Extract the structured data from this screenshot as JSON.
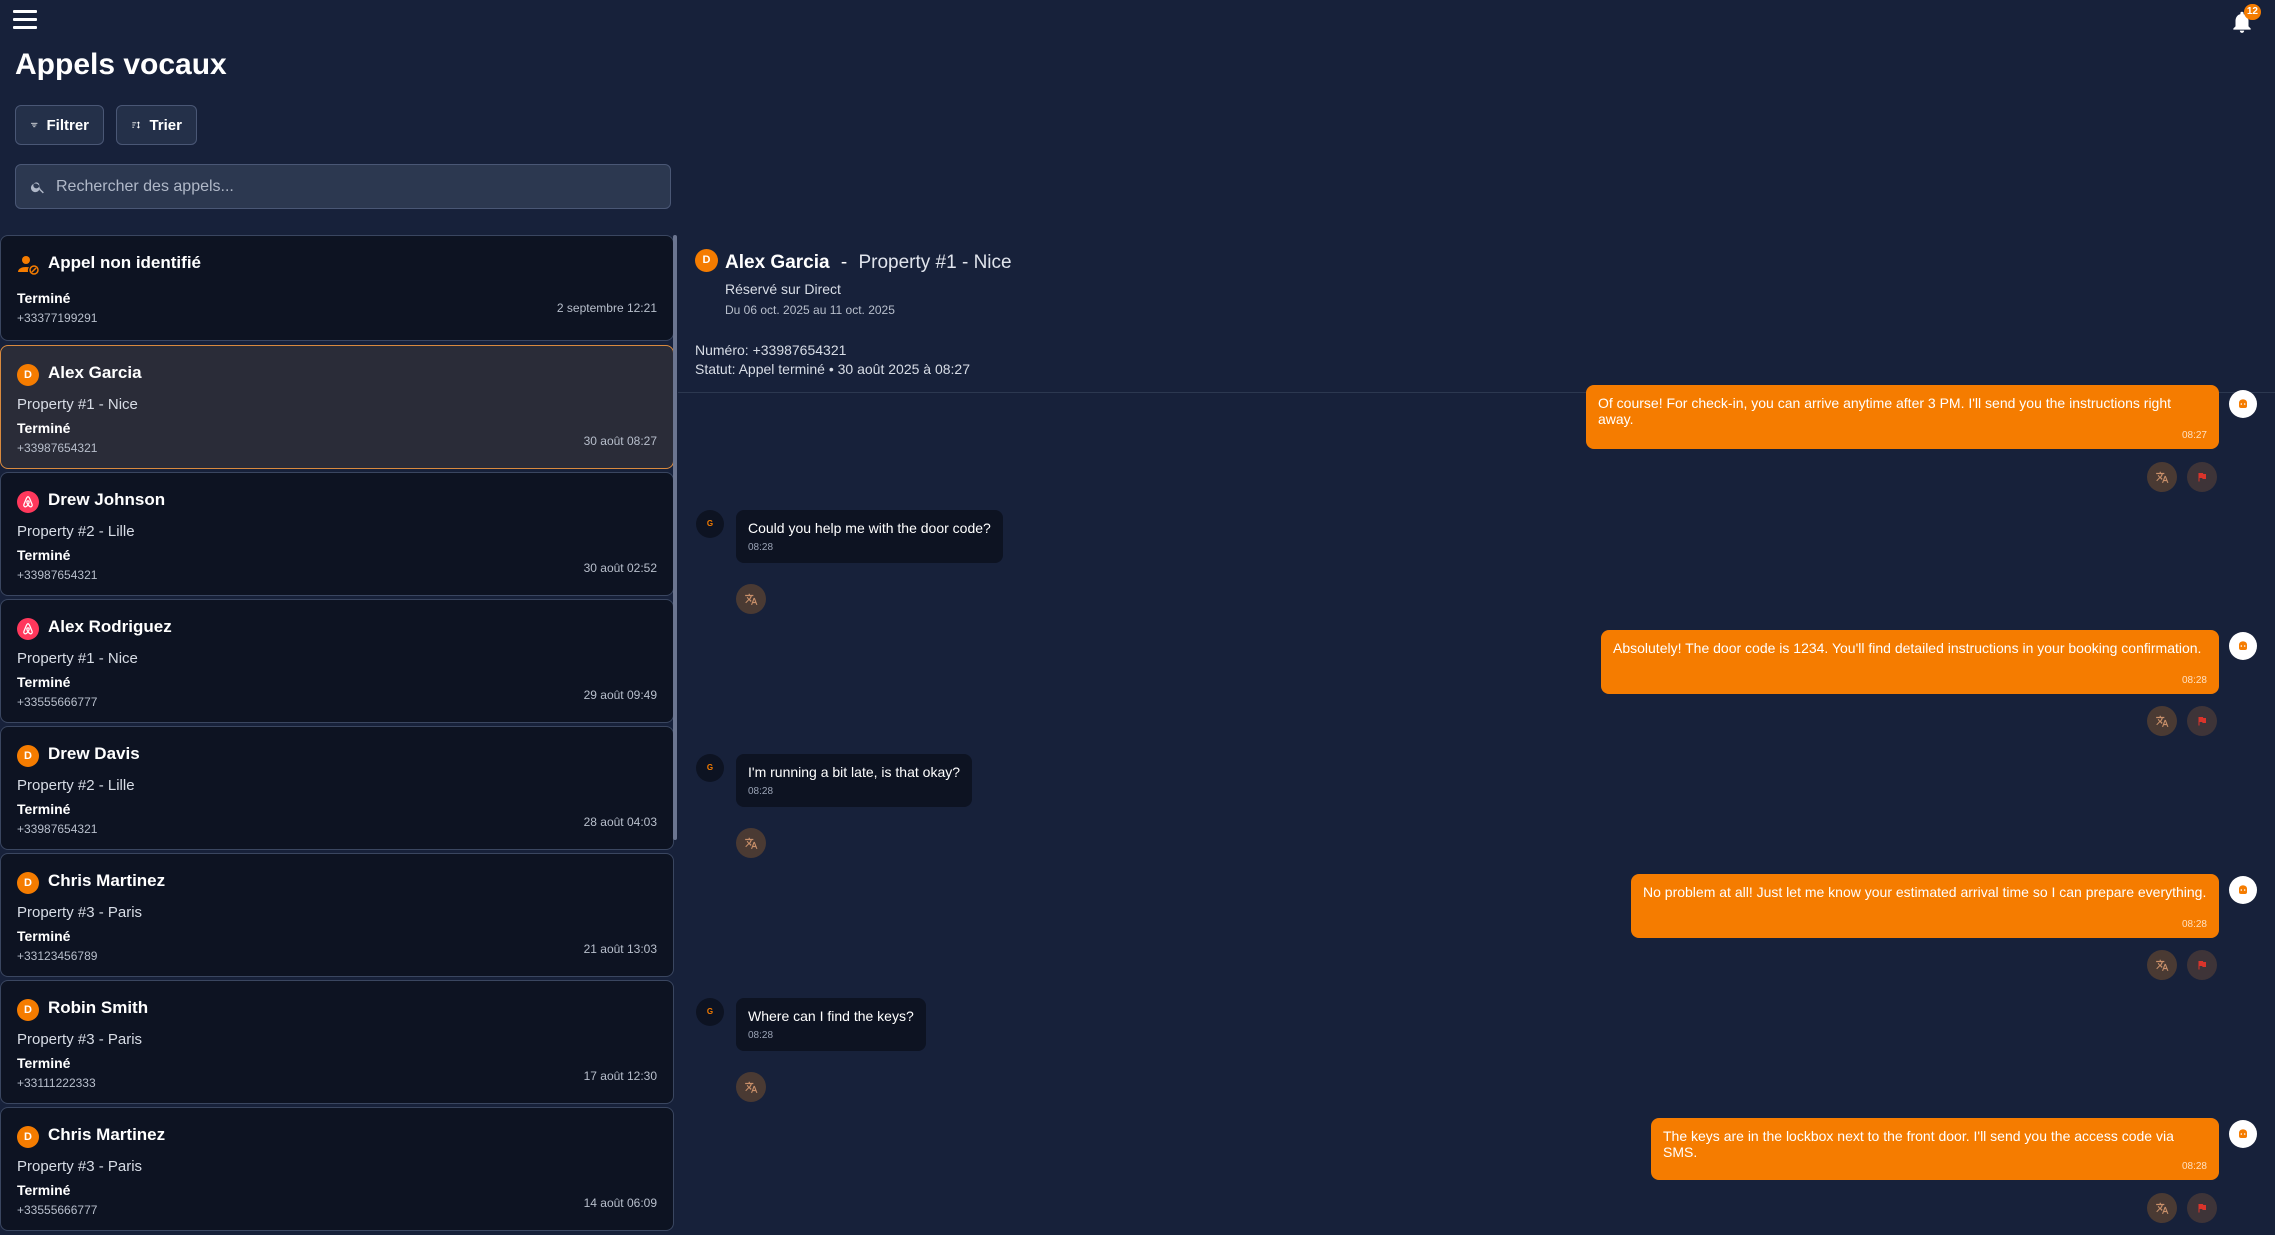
{
  "header": {
    "notification_count": "12"
  },
  "page": {
    "title": "Appels vocaux"
  },
  "toolbar": {
    "filter_label": "Filtrer",
    "sort_label": "Trier"
  },
  "search": {
    "placeholder": "Rechercher des appels..."
  },
  "calls": [
    {
      "name": "Appel non identifié",
      "property": "",
      "status": "Terminé",
      "phone": "+33377199291",
      "date": "2 septembre 12:21",
      "avatar": "unknown"
    },
    {
      "name": "Alex Garcia",
      "property": "Property #1 - Nice",
      "status": "Terminé",
      "phone": "+33987654321",
      "date": "30 août 08:27",
      "avatar": "D"
    },
    {
      "name": "Drew Johnson",
      "property": "Property #2 - Lille",
      "status": "Terminé",
      "phone": "+33987654321",
      "date": "30 août 02:52",
      "avatar": "airbnb"
    },
    {
      "name": "Alex Rodriguez",
      "property": "Property #1 - Nice",
      "status": "Terminé",
      "phone": "+33555666777",
      "date": "29 août 09:49",
      "avatar": "airbnb"
    },
    {
      "name": "Drew Davis",
      "property": "Property #2 - Lille",
      "status": "Terminé",
      "phone": "+33987654321",
      "date": "28 août 04:03",
      "avatar": "D"
    },
    {
      "name": "Chris Martinez",
      "property": "Property #3 - Paris",
      "status": "Terminé",
      "phone": "+33123456789",
      "date": "21 août 13:03",
      "avatar": "D"
    },
    {
      "name": "Robin Smith",
      "property": "Property #3 - Paris",
      "status": "Terminé",
      "phone": "+33111222333",
      "date": "17 août 12:30",
      "avatar": "D"
    },
    {
      "name": "Chris Martinez",
      "property": "Property #3 - Paris",
      "status": "Terminé",
      "phone": "+33555666777",
      "date": "14 août 06:09",
      "avatar": "D"
    }
  ],
  "detail": {
    "avatar": "D",
    "name": "Alex Garcia",
    "separator": "-",
    "property": "Property #1 - Nice",
    "booked_on": "Réservé sur Direct",
    "stay_dates": "Du 06 oct. 2025 au 11 oct. 2025",
    "number": "Numéro: +33987654321",
    "status": "Statut: Appel terminé • 30 août 2025 à 08:27"
  },
  "messages": [
    {
      "dir": "out",
      "text": "Of course! For check-in, you can arrive anytime after 3 PM. I'll send you the instructions right away.",
      "time": "08:27"
    },
    {
      "dir": "in",
      "avatar": "G",
      "text": "Could you help me with the door code?",
      "time": "08:28"
    },
    {
      "dir": "out",
      "text": "Absolutely! The door code is 1234. You'll find detailed instructions in your booking confirmation.",
      "time": "08:28"
    },
    {
      "dir": "in",
      "avatar": "G",
      "text": "I'm running a bit late, is that okay?",
      "time": "08:28"
    },
    {
      "dir": "out",
      "text": "No problem at all! Just let me know your estimated arrival time so I can prepare everything.",
      "time": "08:28"
    },
    {
      "dir": "in",
      "avatar": "G",
      "text": "Where can I find the keys?",
      "time": "08:28"
    },
    {
      "dir": "out",
      "text": "The keys are in the lockbox next to the front door. I'll send you the access code via SMS.",
      "time": "08:28"
    }
  ],
  "icons": {
    "menu": "menu-icon",
    "bell": "bell-icon",
    "filter": "filter-icon",
    "sort": "sort-icon",
    "search": "search-icon",
    "translate": "translate-icon",
    "flag": "flag-icon",
    "bot": "bot-icon"
  },
  "colors": {
    "accent": "#f57c00",
    "background": "#17213a",
    "card": "#0d1322",
    "airbnb": "#ff385c"
  }
}
